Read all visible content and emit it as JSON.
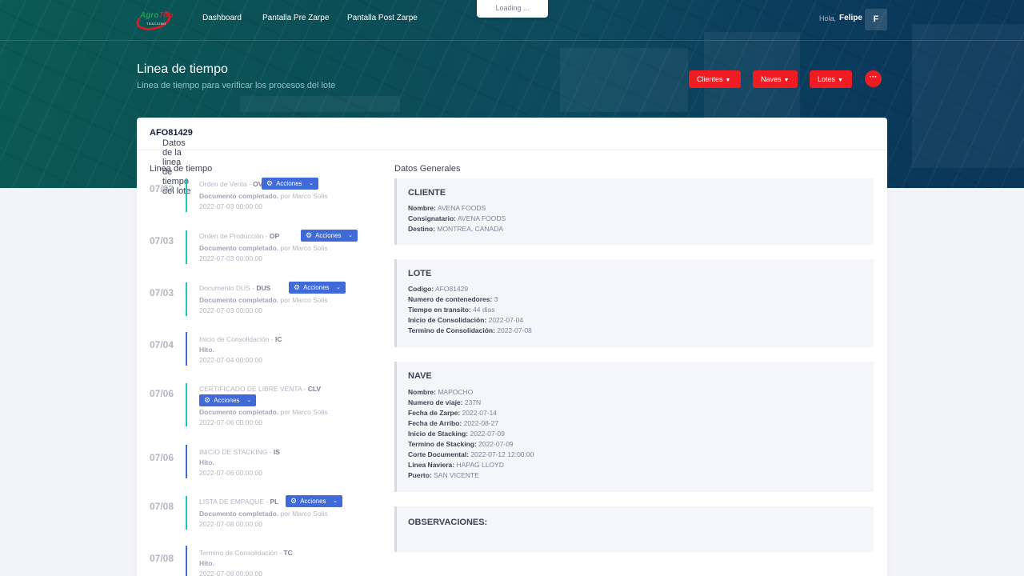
{
  "nav": {
    "logo": {
      "word_a": "Agro",
      "word_b": "Top",
      "tagline": "TRACKING"
    },
    "links": [
      "Dashboard",
      "Pantalla Pre Zarpe",
      "Pantalla Post Zarpe"
    ],
    "loading": "Loading ...",
    "greeting": "Hola,",
    "user_name": "Felipe",
    "avatar_initial": "F"
  },
  "page": {
    "title": "Linea de tiempo",
    "subtitle": "Linea de tiempo para verificar los procesos del lote",
    "buttons": [
      "Clientes",
      "Naves",
      "Lotes"
    ],
    "more": "···"
  },
  "card": {
    "head_prefix": "Datos de la linea de tiempo del lote",
    "lot_code": "AFO81429",
    "timeline_title": "Linea de tiempo",
    "general_title": "Datos Generales"
  },
  "timeline": [
    {
      "date": "07/03",
      "title": "Orden de Venta - ",
      "code": "OV",
      "status": "Documento completado.",
      "by": " por Marco Solis",
      "ts": "2022-07-03 00:00:00",
      "actions": "Acciones",
      "color": "#1bc5bd"
    },
    {
      "date": "07/03",
      "title": "Orden de Producción - ",
      "code": "OP",
      "status": "Documento completado.",
      "by": " por Marco Solis",
      "ts": "2022-07-03 00:00:00",
      "actions": "Acciones",
      "color": "#1bc5bd"
    },
    {
      "date": "07/03",
      "title": "Documento DUS - ",
      "code": "DUS",
      "status": "Documento completado.",
      "by": " por Marco Solis",
      "ts": "2022-07-03 00:00:00",
      "actions": "Acciones",
      "color": "#1bc5bd"
    },
    {
      "date": "07/04",
      "title": "Inicio de Consolidación - ",
      "code": "IC",
      "status": "Hito.",
      "by": "",
      "ts": "2022-07-04 00:00:00",
      "actions": "",
      "color": "#3f6ad8"
    },
    {
      "date": "07/06",
      "title": "CERTIFICADO DE LIBRE VENTA - ",
      "code": "CLV",
      "status": "Documento completado.",
      "by": " por Marco Solis",
      "ts": "2022-07-06 00:00:00",
      "actions": "Acciones",
      "color": "#1bc5bd"
    },
    {
      "date": "07/06",
      "title": "INICIO DE STACKING - ",
      "code": "IS",
      "status": "Hito.",
      "by": "",
      "ts": "2022-07-06 00:00:00",
      "actions": "",
      "color": "#3f6ad8"
    },
    {
      "date": "07/08",
      "title": "LISTA DE EMPAQUE - ",
      "code": "PL",
      "status": "Documento completado.",
      "by": " por Marco Solis",
      "ts": "2022-07-08 00:00:00",
      "actions": "Acciones",
      "color": "#1bc5bd"
    },
    {
      "date": "07/08",
      "title": "Termino de Consolidación - ",
      "code": "TC",
      "status": "Hito.",
      "by": "",
      "ts": "2022-07-08 00:00:00",
      "actions": "",
      "color": "#3f6ad8"
    }
  ],
  "general": {
    "cliente": {
      "title": "CLIENTE",
      "rows": [
        {
          "label": "Nombre:",
          "value": " AVENA FOODS"
        },
        {
          "label": "Consignatario:",
          "value": " AVENA FOODS"
        },
        {
          "label": "Destino:",
          "value": " MONTREA, CANADA"
        }
      ]
    },
    "lote": {
      "title": "LOTE",
      "rows": [
        {
          "label": "Codigo:",
          "value": " AFO81429"
        },
        {
          "label": "Numero de contenedores:",
          "value": " 3"
        },
        {
          "label": "Tiempo en transito:",
          "value": " 44 dias"
        },
        {
          "label": "Inicio de Consolidación:",
          "value": " 2022-07-04"
        },
        {
          "label": "Termino de Consolidación:",
          "value": " 2022-07-08"
        }
      ]
    },
    "nave": {
      "title": "NAVE",
      "rows": [
        {
          "label": "Nombre:",
          "value": " MAPOCHO"
        },
        {
          "label": "Numero de viaje:",
          "value": " 237N"
        },
        {
          "label": "Fecha de Zarpe:",
          "value": " 2022-07-14"
        },
        {
          "label": "Fecha de Arribo:",
          "value": " 2022-08-27"
        },
        {
          "label": "Inicio de Stacking:",
          "value": " 2022-07-09"
        },
        {
          "label": "Termino de Stacking:",
          "value": " 2022-07-09"
        },
        {
          "label": "Corte Documental:",
          "value": " 2022-07-12 12:00:00"
        },
        {
          "label": "Linea Naviera:",
          "value": " HAPAG LLOYD"
        },
        {
          "label": "Puerto:",
          "value": " SAN VICENTE"
        }
      ]
    },
    "observaciones": {
      "title": "OBSERVACIONES:"
    }
  }
}
